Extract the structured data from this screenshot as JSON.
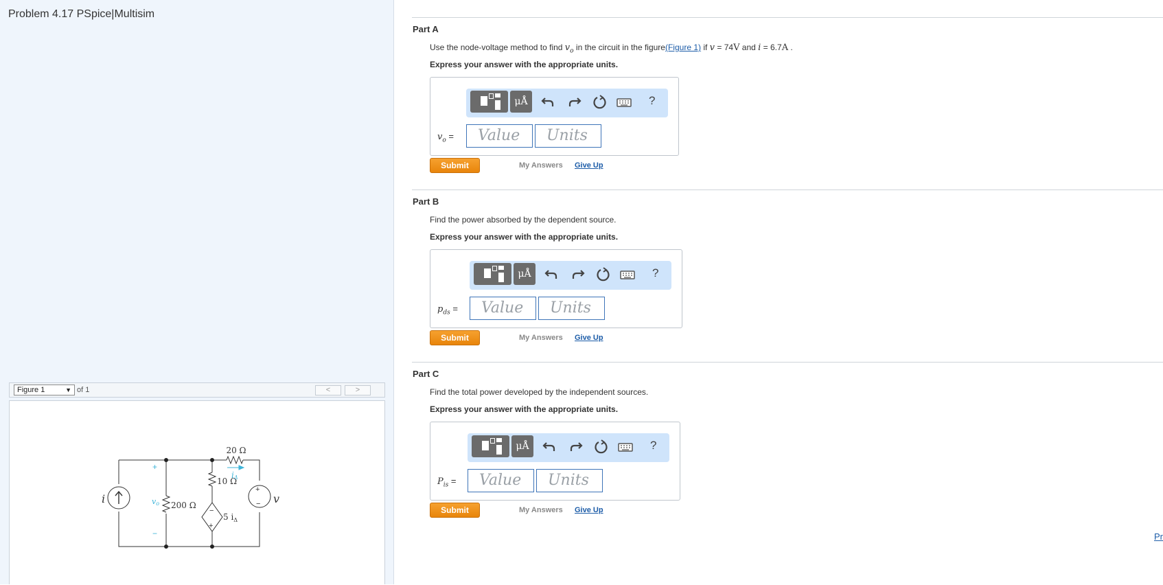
{
  "problem": {
    "title": "Problem 4.17 PSpice|Multisim"
  },
  "figure": {
    "select_value": "Figure 1",
    "of_text": "of 1",
    "prev_label": "<",
    "next_label": ">",
    "circuit": {
      "r20": "20 Ω",
      "r10": "10 Ω",
      "r200": "200 Ω",
      "i_label": "i",
      "v_label": "v",
      "vo_label": "v",
      "vo_sub": "o",
      "i_delta": "i",
      "i_delta_sub": "Δ",
      "dep_label": "5 i",
      "dep_sub": "Δ",
      "plus": "+",
      "minus": "−"
    }
  },
  "toolbar": {
    "units_label": "μÅ",
    "help_label": "?"
  },
  "parts": [
    {
      "label": "Part A",
      "prompt_pre": "Use the node-voltage method to find ",
      "prompt_var": "v",
      "prompt_var_sub": "o",
      "prompt_mid": " in the circuit in the figure",
      "prompt_link": "(Figure 1)",
      "prompt_post1": " if ",
      "prompt_v": "v",
      "prompt_eq1": " = 74",
      "prompt_unit1": "V",
      "prompt_and": " and ",
      "prompt_i": "i",
      "prompt_eq2": " = 6.7",
      "prompt_unit2": "A",
      "prompt_end": " .",
      "express": "Express your answer with the appropriate units.",
      "var": "v",
      "var_sub": "o",
      "eq": " =",
      "value_placeholder": "Value",
      "units_placeholder": "Units",
      "submit": "Submit",
      "my_answers": "My Answers",
      "give_up": "Give Up"
    },
    {
      "label": "Part B",
      "prompt": "Find the power absorbed by the dependent source.",
      "express": "Express your answer with the appropriate units.",
      "var": "p",
      "var_sub": "ds",
      "eq": " =",
      "value_placeholder": "Value",
      "units_placeholder": "Units",
      "submit": "Submit",
      "my_answers": "My Answers",
      "give_up": "Give Up"
    },
    {
      "label": "Part C",
      "prompt": "Find the total power developed by the independent sources.",
      "express": "Express your answer with the appropriate units.",
      "var": "P",
      "var_sub": "is",
      "eq": " =",
      "value_placeholder": "Value",
      "units_placeholder": "Units",
      "submit": "Submit",
      "my_answers": "My Answers",
      "give_up": "Give Up"
    }
  ],
  "footer": {
    "next_link": "Pr"
  },
  "icons": [
    "template-icon",
    "units-icon",
    "undo-icon",
    "redo-icon",
    "reset-icon",
    "keyboard-icon",
    "help-icon"
  ],
  "colors": {
    "submit": "#e8850b",
    "link": "#1c5ca8",
    "toolbar_bg": "#cfe4fb",
    "left_bg": "#eff5fc"
  }
}
